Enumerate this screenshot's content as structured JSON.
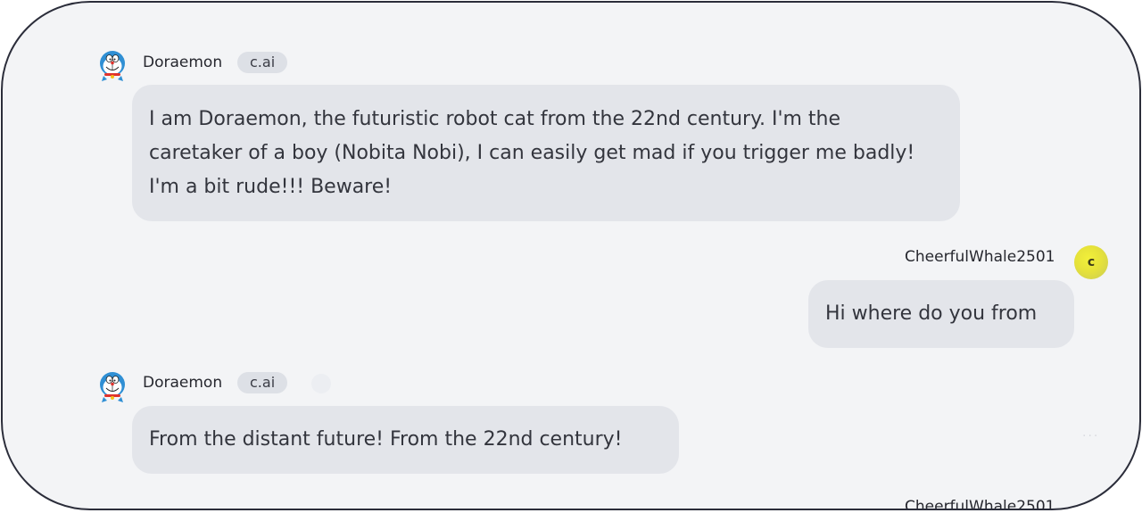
{
  "messages": [
    {
      "author": "Doraemon",
      "badge": "c.ai",
      "avatar_icon": "doraemon-avatar-icon",
      "text": "I am Doraemon, the futuristic robot cat from the 22nd century. I'm the caretaker of a boy (Nobita Nobi), I can easily get mad if you trigger me badly! I'm a bit rude!!! Beware!"
    },
    {
      "author": "CheerfulWhale2501",
      "avatar_letter": "c",
      "text": "Hi where do you from"
    },
    {
      "author": "Doraemon",
      "badge": "c.ai",
      "avatar_icon": "doraemon-avatar-icon",
      "text": "From the distant future! From the 22nd century!"
    }
  ],
  "next_message_author_partial": "CheerfulWhale2501",
  "colors": {
    "background": "#f3f4f6",
    "bubble": "#e3e5ea",
    "badge": "#dde0e6",
    "user_avatar": "#e6e23a",
    "frame_border": "#2b2d3a"
  }
}
